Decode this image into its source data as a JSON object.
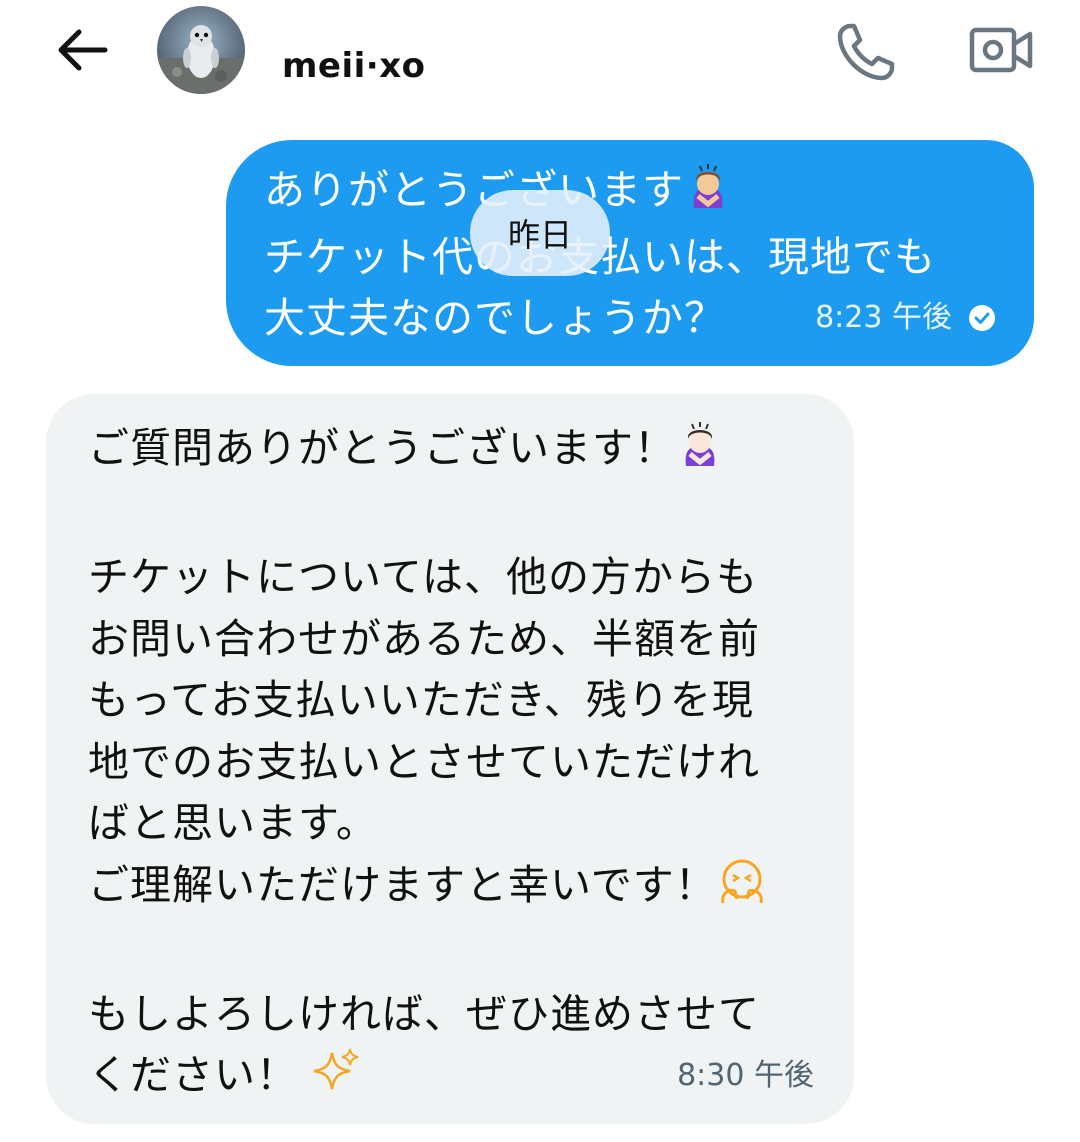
{
  "header": {
    "contact_name": "meii·xo",
    "avatar_icon": "penguin-avatar",
    "back_icon": "arrow-left-icon",
    "call_icon": "phone-icon",
    "video_icon": "video-camera-icon"
  },
  "date_separator": "昨日",
  "messages": [
    {
      "direction": "outgoing",
      "lines": [
        "ありがとうございます",
        "チケット代のお支払いは、現地でも",
        "大丈夫なのでしょうか？"
      ],
      "emoji": "person-bowing",
      "time": "8:23 午後",
      "status": "read"
    },
    {
      "direction": "incoming",
      "lines": [
        "ご質問ありがとうございます！",
        "",
        "チケットについては、他の方からも",
        "お問い合わせがあるため、半額を前",
        "もってお支払いいただき、残りを現",
        "地でのお支払いとさせていただけれ",
        "ばと思います。",
        "ご理解いただけますと幸いです！",
        "",
        "もしよろしければ、ぜひ進めさせて",
        "ください！"
      ],
      "emojis": [
        "person-bowing",
        "face-with-hands",
        "sparkles"
      ],
      "time": "8:30 午後"
    }
  ],
  "colors": {
    "outgoing_bubble": "#1d9bf0",
    "incoming_bubble": "#eff3f4",
    "sparkle": "#f5a623"
  }
}
